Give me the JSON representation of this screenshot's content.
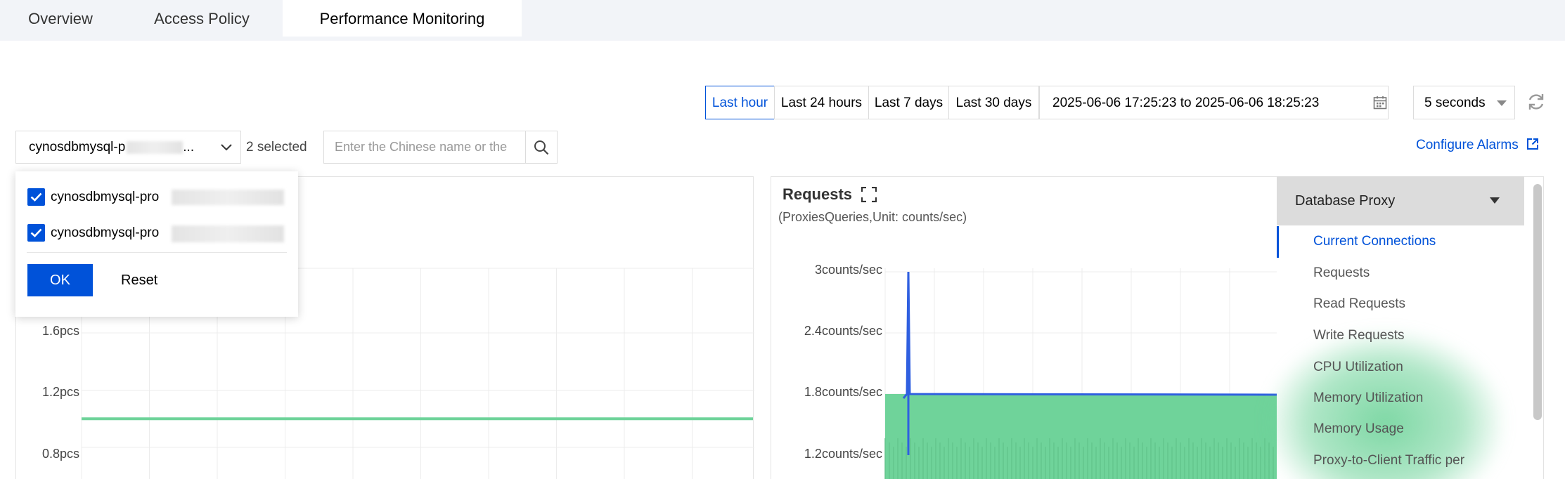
{
  "tabs": [
    {
      "label": "Overview",
      "active": false
    },
    {
      "label": "Access Policy",
      "active": false
    },
    {
      "label": "Performance Monitoring",
      "active": true
    }
  ],
  "time_filter": {
    "buttons": [
      "Last hour",
      "Last 24 hours",
      "Last 7 days",
      "Last 30 days"
    ],
    "active": "Last hour",
    "range_text": "2025-06-06 17:25:23 to 2025-06-06 18:25:23",
    "refresh_interval": "5 seconds"
  },
  "instance_filter": {
    "select_text": "cynosdbmysql-p",
    "select_suffix": "...",
    "selected_count": "2 selected",
    "search_placeholder": "Enter the Chinese name or the",
    "configure_alarms": "Configure Alarms"
  },
  "instance_popup": {
    "items": [
      {
        "label": "cynosdbmysql-pro",
        "checked": true
      },
      {
        "label": "cynosdbmysql-pro",
        "checked": true
      }
    ],
    "ok_label": "OK",
    "reset_label": "Reset"
  },
  "left_chart": {
    "y_ticks": [
      "1.6pcs",
      "1.2pcs",
      "0.8pcs"
    ],
    "series_color": "#6fd39a",
    "value": 1
  },
  "right_chart": {
    "title": "Requests",
    "subtitle": "(ProxiesQueries,Unit: counts/sec)",
    "y_ticks": [
      "3counts/sec",
      "2.4counts/sec",
      "1.8counts/sec",
      "1.2counts/sec"
    ],
    "series_colors": {
      "primary": "#2f5fe0",
      "secondary": "#6fd39a"
    }
  },
  "chart_data": [
    {
      "type": "line",
      "ylim": [
        0.8,
        1.6
      ],
      "series": [
        {
          "values": [
            1,
            1,
            1,
            1,
            1,
            1,
            1,
            1,
            1,
            1
          ]
        }
      ]
    },
    {
      "type": "area",
      "title": "Requests",
      "subtitle": "(ProxiesQueries,Unit: counts/sec)",
      "ylim": [
        1.2,
        3
      ],
      "series": [
        {
          "values": [
            1.2,
            3,
            1.3,
            1.2,
            1.2,
            1.2,
            1.2,
            1.2
          ]
        },
        {
          "values": [
            1.8,
            1.8,
            1.8,
            1.8,
            1.8,
            1.8,
            1.8,
            1.8
          ]
        }
      ]
    }
  ],
  "metric_menu": {
    "header": "Database Proxy",
    "items": [
      {
        "label": "Current Connections",
        "active": true
      },
      {
        "label": "Requests",
        "active": false
      },
      {
        "label": "Read Requests",
        "active": false
      },
      {
        "label": "Write Requests",
        "active": false
      },
      {
        "label": "CPU Utilization",
        "active": false
      },
      {
        "label": "Memory Utilization",
        "active": false
      },
      {
        "label": "Memory Usage",
        "active": false
      },
      {
        "label": "Proxy-to-Client Traffic per",
        "active": false
      }
    ]
  },
  "colors": {
    "accent": "#0052d9",
    "tab_bg": "#f2f4f8",
    "green": "#6fd39a"
  }
}
